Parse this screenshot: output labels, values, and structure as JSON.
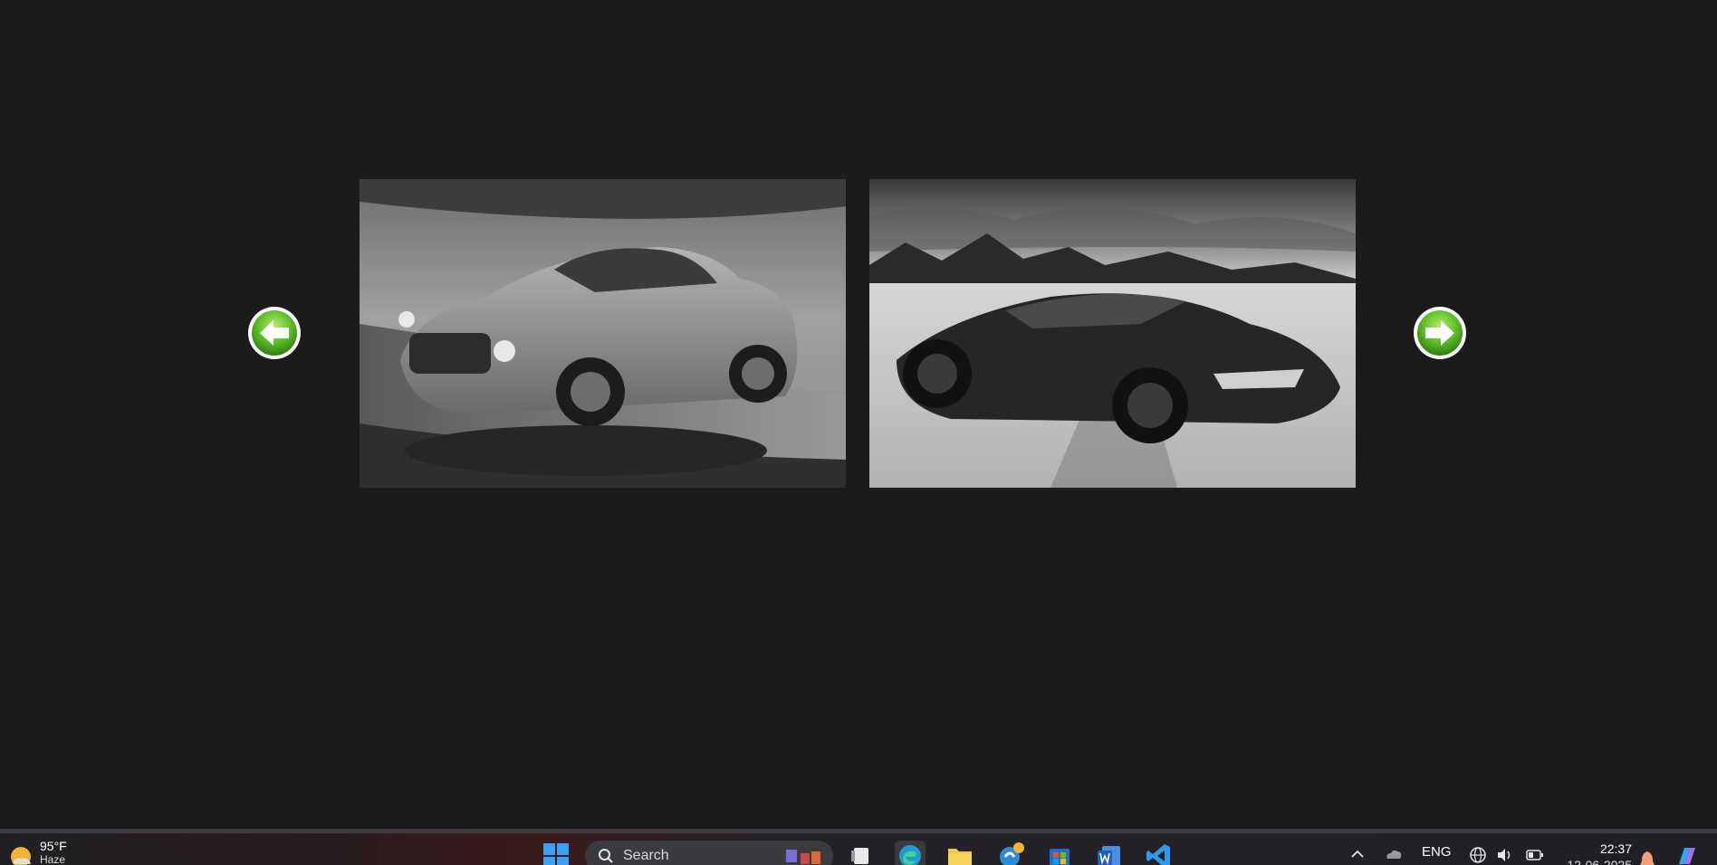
{
  "gallery": {
    "images": [
      {
        "name": "classic-coupe-photo",
        "style": "grayscale"
      },
      {
        "name": "hypercar-desert-photo",
        "style": "grayscale"
      }
    ],
    "nav": {
      "prev_icon": "left-arrow-icon",
      "next_icon": "right-arrow-icon",
      "color": "#5fbf2a"
    }
  },
  "taskbar": {
    "weather": {
      "temp": "95°F",
      "condition": "Haze",
      "icon": "weather-sun-icon"
    },
    "search": {
      "label": "Search"
    },
    "apps": [
      "task-view",
      "edge",
      "file-explorer",
      "chat",
      "microsoft-store",
      "word",
      "vscode"
    ],
    "tray": {
      "language": "ENG"
    },
    "clock": {
      "time": "22:37",
      "date": "12-06-2025"
    }
  }
}
